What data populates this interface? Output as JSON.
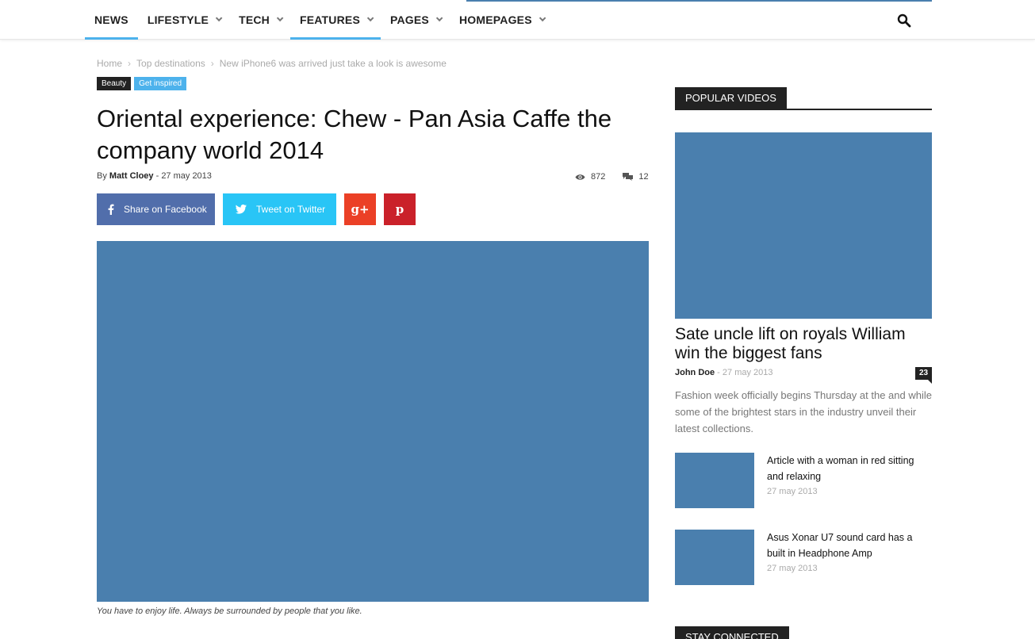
{
  "nav": {
    "items": [
      {
        "label": "NEWS",
        "has_dropdown": false,
        "active": true
      },
      {
        "label": "LIFESTYLE",
        "has_dropdown": true,
        "active": false
      },
      {
        "label": "TECH",
        "has_dropdown": true,
        "active": false
      },
      {
        "label": "FEATURES",
        "has_dropdown": true,
        "active": true
      },
      {
        "label": "PAGES",
        "has_dropdown": true,
        "active": false
      },
      {
        "label": "HOMEPAGES",
        "has_dropdown": true,
        "active": false
      }
    ],
    "search_icon": "search-icon"
  },
  "breadcrumb": [
    "Home",
    "Top destinations",
    "New iPhone6 was arrived just take a look is awesome"
  ],
  "tags": [
    "Beauty",
    "Get inspired"
  ],
  "post": {
    "title": "Oriental experience: Chew - Pan Asia Caffe the company world 2014",
    "by": "By",
    "author": "Matt Cloey",
    "date_sep": " - ",
    "date": "27 may 2013",
    "views": "872",
    "comments": "12",
    "caption": "You have to enjoy life. Always be surrounded by people that you like."
  },
  "share": {
    "facebook_label": "Share on Facebook",
    "twitter_label": "Tweet on Twitter",
    "googleplus_icon": "google-plus-icon",
    "pinterest_icon": "pinterest-icon"
  },
  "sidebar": {
    "popular_videos": {
      "heading": "POPULAR VIDEOS",
      "main": {
        "title": "Sate uncle lift on royals William win the biggest fans",
        "author": "John Doe",
        "date_sep": " - ",
        "date": "27 may 2013",
        "comments": "23",
        "excerpt": "Fashion week officially begins Thursday at the and while some of the brightest stars in the industry unveil their latest collections."
      },
      "items": [
        {
          "title": "Article with a woman in red sitting and relaxing",
          "date": "27 may 2013"
        },
        {
          "title": "Asus Xonar U7 sound card has a built in Headphone Amp",
          "date": "27 may 2013"
        }
      ]
    },
    "stay_connected": {
      "heading": "STAY CONNECTED"
    }
  },
  "colors": {
    "accent": "#4db2ec",
    "placeholder": "#4a7fae",
    "facebook": "#516eab",
    "twitter": "#29c5f6",
    "googleplus": "#eb4026",
    "pinterest": "#ca212a"
  }
}
